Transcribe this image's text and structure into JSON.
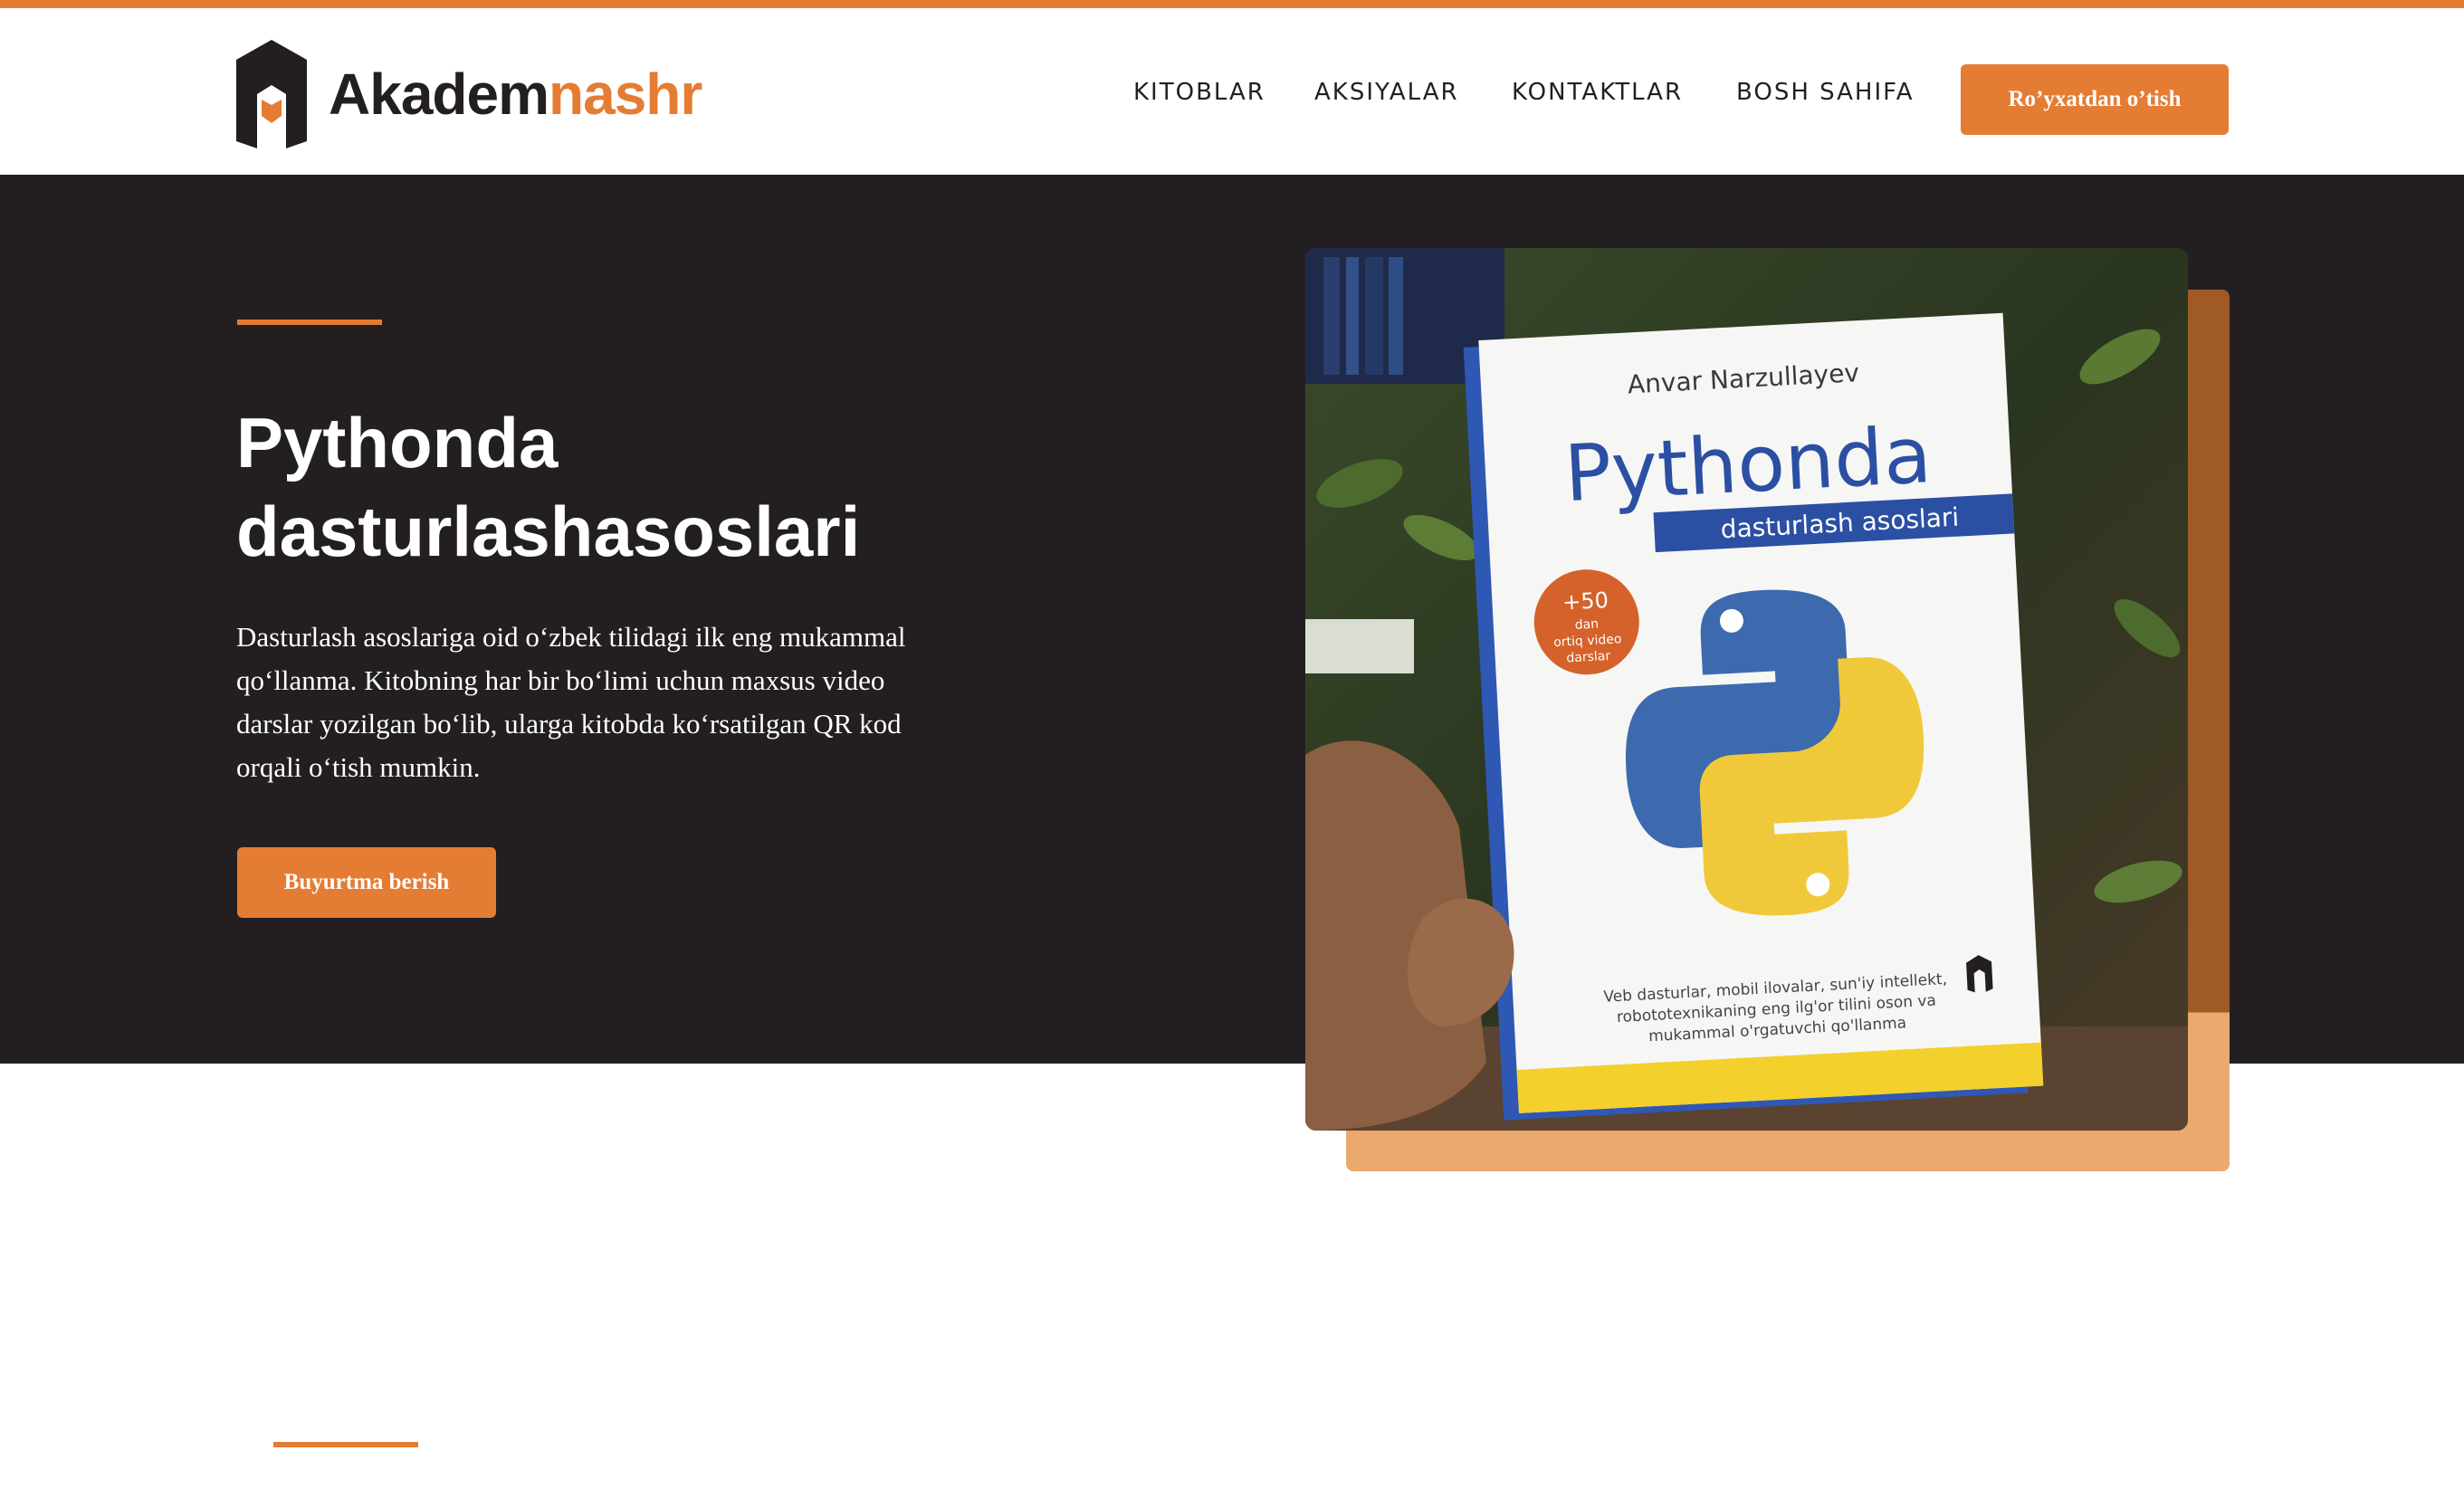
{
  "brand": {
    "name_part1": "Akadem",
    "name_part2": "nashr"
  },
  "nav": {
    "items": [
      "KITOBLAR",
      "AKSIYALAR",
      "KONTAKTLAR",
      "BOSH SAHIFA"
    ],
    "register_label": "Ro’yxatdan o’tish"
  },
  "hero": {
    "title_line1": "Pythonda",
    "title_line2": "dasturlashasoslari",
    "description": "Dasturlash asoslariga oid oʻzbek tilidagi ilk eng mukammal qoʻllanma. Kitobning har bir boʻlimi uchun maxsus video darslar yozilgan boʻlib, ularga kitobda koʻrsatilgan QR kod orqali oʻtish mumkin.",
    "order_label": "Buyurtma berish"
  },
  "book": {
    "author": "Anvar Narzullayev",
    "title": "Pythonda",
    "subtitle": "dasturlash asoslari",
    "badge_line1": "+50",
    "badge_line2": "dan",
    "badge_line3": "ortiq video",
    "badge_line4": "darslar",
    "footer_line1": "Veb dasturlar, mobil ilovalar, sun'iy intellekt,",
    "footer_line2": "robototexnikaning eng ilg'or tilini oson va",
    "footer_line3": "mukammal o'rgatuvchi qo'llanma"
  },
  "colors": {
    "accent": "#e57c33",
    "dark": "#231f20",
    "white": "#ffffff"
  }
}
